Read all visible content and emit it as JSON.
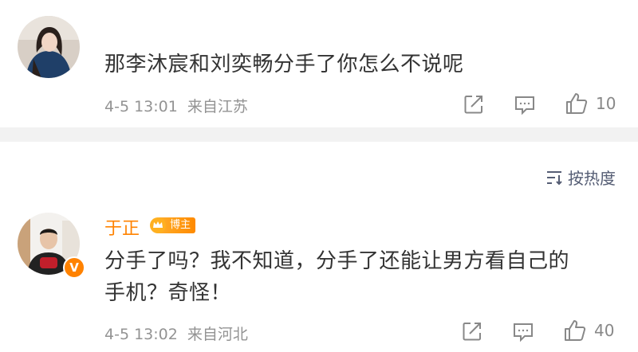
{
  "comments": [
    {
      "text": "那李沐宸和刘奕畅分手了你怎么不说呢",
      "time": "4-5 13:01",
      "location": "来自江苏",
      "likes": "10"
    },
    {
      "username": "于正",
      "badge": "博主",
      "verified_mark": "V",
      "text_line1": "分手了吗？我不知道，分手了还能让男方看自己的",
      "text_line2": "手机？奇怪！",
      "time": "4-5 13:02",
      "location": "来自河北",
      "likes": "40"
    }
  ],
  "sort": {
    "label": "按热度"
  },
  "colors": {
    "accent": "#ff8200",
    "meta": "#939393",
    "divider": "#f2f2f2"
  },
  "icons": [
    "share-icon",
    "comment-icon",
    "like-icon",
    "sort-icon",
    "crown-icon"
  ]
}
